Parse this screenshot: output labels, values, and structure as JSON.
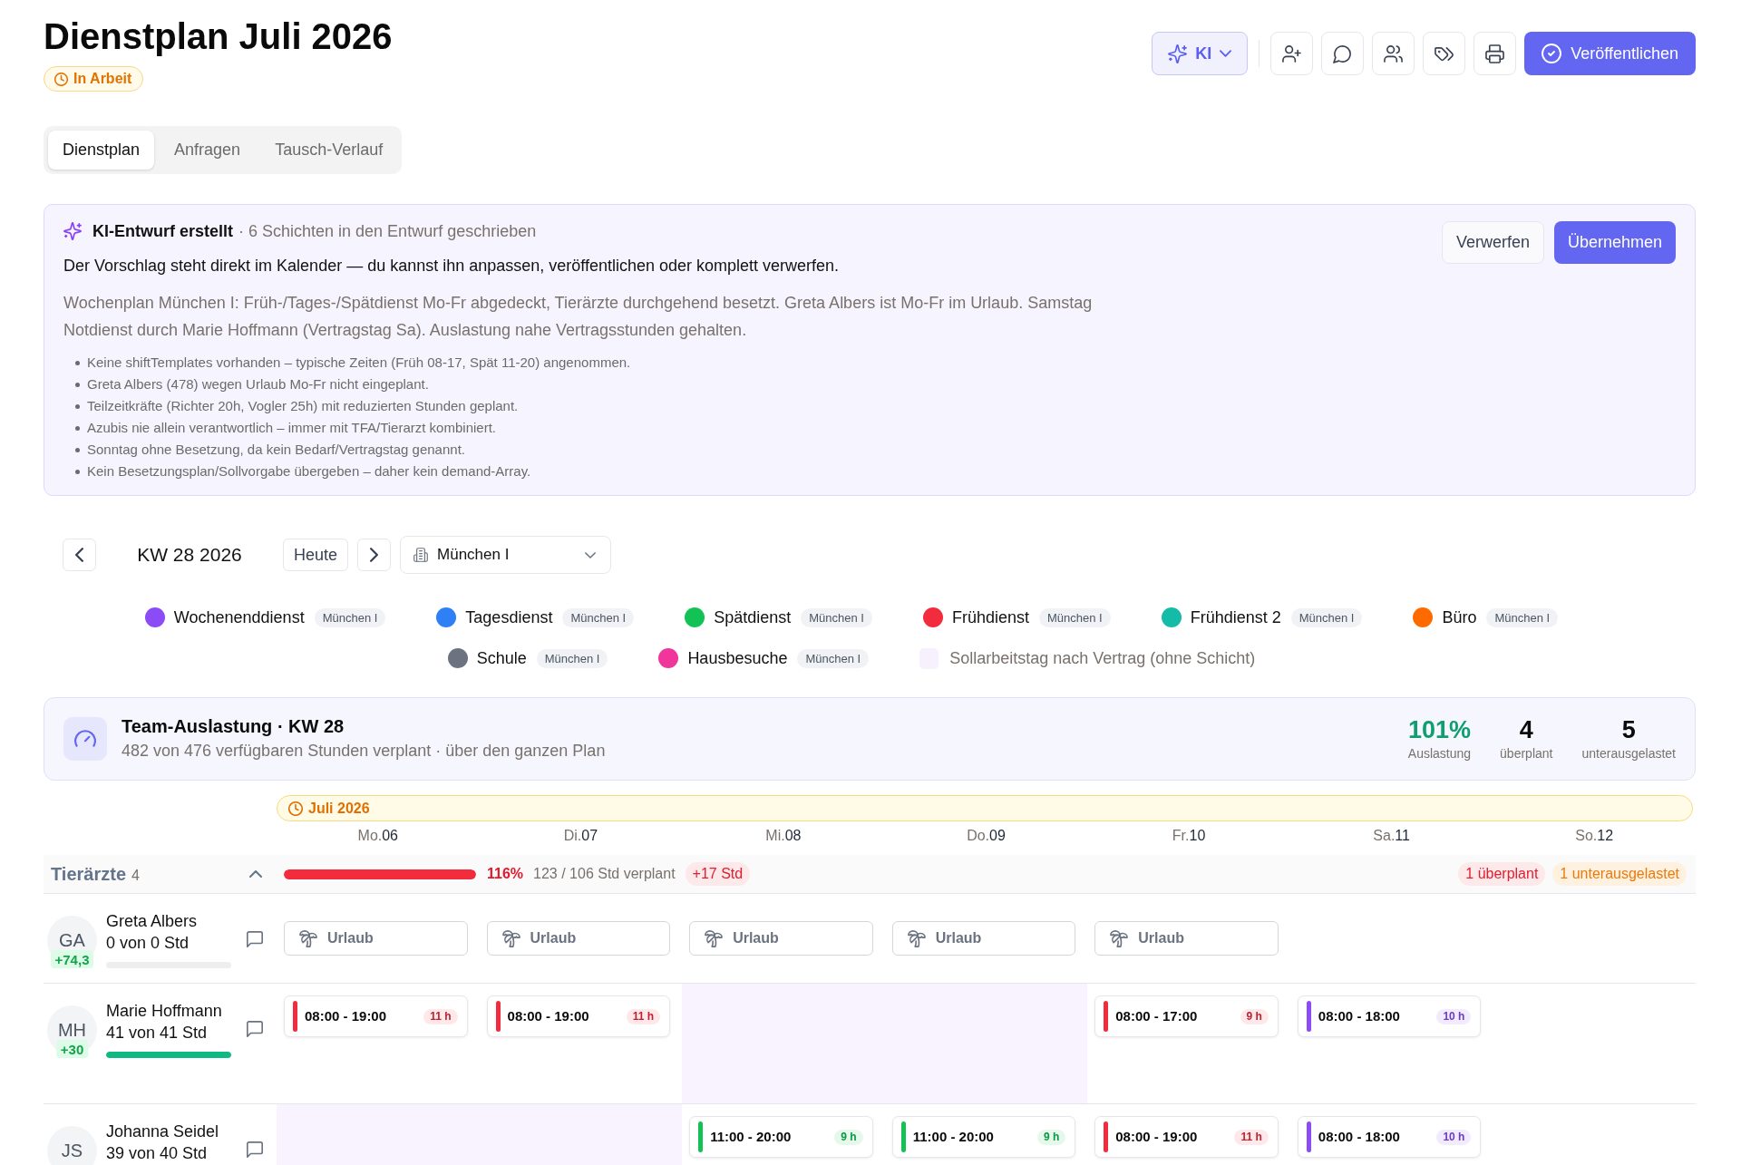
{
  "header": {
    "title": "Dienstplan Juli 2026",
    "status": {
      "label": "In Arbeit"
    },
    "ai_button": {
      "label": "KI"
    },
    "publish_button": {
      "label": "Veröffentlichen"
    }
  },
  "tabs": [
    {
      "label": "Dienstplan",
      "selected": true
    },
    {
      "label": "Anfragen",
      "selected": false
    },
    {
      "label": "Tausch-Verlauf",
      "selected": false
    }
  ],
  "ai_draft": {
    "title": "KI-Entwurf erstellt",
    "meta": "· 6 Schichten in den Entwurf geschrieben",
    "lead": "Der Vorschlag steht direkt im Kalender — du kannst ihn anpassen, veröffentlichen oder komplett verwerfen.",
    "summary": "Wochenplan München I: Früh-/Tages-/Spätdienst Mo-Fr abgedeckt, Tierärzte durchgehend besetzt. Greta Albers ist Mo-Fr im Urlaub. Samstag Notdienst durch Marie Hoffmann (Vertragstag Sa). Auslastung nahe Vertragsstunden gehalten.",
    "notes": [
      "Keine shiftTemplates vorhanden – typische Zeiten (Früh 08-17, Spät 11-20) angenommen.",
      "Greta Albers (478) wegen Urlaub Mo-Fr nicht eingeplant.",
      "Teilzeitkräfte (Richter 20h, Vogler 25h) mit reduzierten Stunden geplant.",
      "Azubis nie allein verantwortlich – immer mit TFA/Tierarzt kombiniert.",
      "Sonntag ohne Besetzung, da kein Bedarf/Vertragstag genannt.",
      "Kein Besetzungsplan/Sollvorgabe übergeben – daher kein demand-Array."
    ],
    "buttons": [
      {
        "kind": "secondary",
        "label": "Verwerfen"
      },
      {
        "kind": "primary",
        "label": "Übernehmen"
      }
    ]
  },
  "toolbar": {
    "week": "KW 28 2026",
    "today_button": "Heute",
    "location": "München I"
  },
  "legend": [
    {
      "kind": "shift",
      "label": "Wochenenddienst",
      "location": "München I",
      "color": "#8b4cf6"
    },
    {
      "kind": "shift",
      "label": "Tagesdienst",
      "location": "München I",
      "color": "#2f7ff6"
    },
    {
      "kind": "shift",
      "label": "Spätdienst",
      "location": "München I",
      "color": "#12c254"
    },
    {
      "kind": "shift",
      "label": "Frühdienst",
      "location": "München I",
      "color": "#f22c3d"
    },
    {
      "kind": "shift",
      "label": "Frühdienst 2",
      "location": "München I",
      "color": "#14bba6"
    },
    {
      "kind": "shift",
      "label": "Büro",
      "location": "München I",
      "color": "#ff6a00"
    },
    {
      "kind": "shift",
      "label": "Schule",
      "location": "München I",
      "color": "#6b7280"
    },
    {
      "kind": "shift",
      "label": "Hausbesuche",
      "location": "München I",
      "color": "#f0369a"
    },
    {
      "kind": "swatch",
      "label": "Sollarbeitstag nach Vertrag (ohne Schicht)",
      "color": "#f7f1fe"
    }
  ],
  "utilization": {
    "title": "Team-Auslastung · KW 28",
    "subtitle": "482 von 476 verfügbaren Stunden verplant · über den ganzen Plan",
    "stats": [
      {
        "kind": "rate",
        "value": "101%",
        "label": "Auslastung"
      },
      {
        "kind": "count",
        "value": "4",
        "label": "überplant"
      },
      {
        "kind": "count",
        "value": "5",
        "label": "unterausgelastet"
      }
    ]
  },
  "calendar": {
    "month": "Juli 2026",
    "days": [
      {
        "weekday": "Mo.",
        "date": "06"
      },
      {
        "weekday": "Di.",
        "date": "07"
      },
      {
        "weekday": "Mi.",
        "date": "08"
      },
      {
        "weekday": "Do.",
        "date": "09"
      },
      {
        "weekday": "Fr.",
        "date": "10"
      },
      {
        "weekday": "Sa.",
        "date": "11"
      },
      {
        "weekday": "So.",
        "date": "12"
      }
    ],
    "groups": [
      {
        "name": "Tierärzte",
        "count": "4",
        "expanded": true,
        "level": 1,
        "percent": "116%",
        "hours": "123 / 106 Std verplant",
        "delta": "+17 Std",
        "flags": [
          {
            "kind": "overplanned",
            "label": "1 überplant"
          },
          {
            "kind": "underutilized",
            "label": "1 unterausgelastet"
          }
        ],
        "employees": [
          {
            "initials": "GA",
            "name": "Greta Albers",
            "hours": "0 von 0 Std",
            "balance": "+74,3",
            "level": 0,
            "cells": [
              {
                "kind": "vacation",
                "label": "Urlaub"
              },
              {
                "kind": "vacation",
                "label": "Urlaub"
              },
              {
                "kind": "vacation",
                "label": "Urlaub"
              },
              {
                "kind": "vacation",
                "label": "Urlaub"
              },
              {
                "kind": "vacation",
                "label": "Urlaub"
              },
              {
                "kind": "empty"
              },
              {
                "kind": "empty"
              }
            ]
          },
          {
            "initials": "MH",
            "name": "Marie Hoffmann",
            "hours": "41 von 41 Std",
            "balance": "+30",
            "level": 1,
            "cells": [
              {
                "kind": "shift",
                "time": "08:00 - 19:00",
                "duration": "11 h",
                "color": "#f22c3d"
              },
              {
                "kind": "shift",
                "time": "08:00 - 19:00",
                "duration": "11 h",
                "color": "#f22c3d"
              },
              {
                "kind": "target_day"
              },
              {
                "kind": "target_day"
              },
              {
                "kind": "shift",
                "time": "08:00 - 17:00",
                "duration": "9 h",
                "color": "#f22c3d"
              },
              {
                "kind": "shift",
                "time": "08:00 - 18:00",
                "duration": "10 h",
                "color": "#8b4cf6"
              },
              {
                "kind": "empty"
              }
            ]
          },
          {
            "initials": "JS",
            "name": "Johanna Seidel",
            "hours": "39 von 40 Std",
            "cells": [
              {
                "kind": "target_day"
              },
              {
                "kind": "target_day"
              },
              {
                "kind": "shift",
                "time": "11:00 - 20:00",
                "duration": "9 h",
                "color": "#12c254"
              },
              {
                "kind": "shift",
                "time": "11:00 - 20:00",
                "duration": "9 h",
                "color": "#12c254"
              },
              {
                "kind": "shift",
                "time": "08:00 - 19:00",
                "duration": "11 h",
                "color": "#f22c3d"
              },
              {
                "kind": "shift",
                "time": "08:00 - 18:00",
                "duration": "10 h",
                "color": "#8b4cf6"
              },
              {
                "kind": "empty"
              }
            ]
          }
        ]
      }
    ]
  }
}
